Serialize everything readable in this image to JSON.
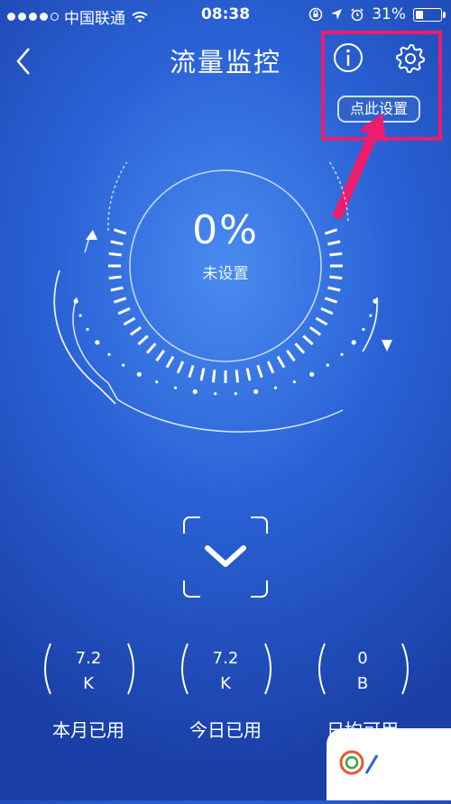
{
  "status_bar": {
    "carrier": "中国联通",
    "time": "08:38",
    "battery_percent": "31%",
    "battery_level": 0.31,
    "signal_bars": 4,
    "icons": [
      "wifi-icon",
      "orientation-lock-icon",
      "location-icon",
      "alarm-icon",
      "battery-icon"
    ]
  },
  "header": {
    "title": "流量监控",
    "tooltip": "点此设置",
    "icons": [
      "back-icon",
      "info-icon",
      "gear-icon"
    ]
  },
  "gauge": {
    "value": "0%",
    "status": "未设置"
  },
  "expand_icon": "chevron-down-icon",
  "stats": [
    {
      "value": "7.2",
      "unit": "K",
      "label": "本月已用"
    },
    {
      "value": "7.2",
      "unit": "K",
      "label": "今日已用"
    },
    {
      "value": "0",
      "unit": "B",
      "label": "日均可用"
    }
  ],
  "colors": {
    "background": "#2a62d6",
    "highlight": "#ee1c6a",
    "foreground": "#ffffff"
  }
}
